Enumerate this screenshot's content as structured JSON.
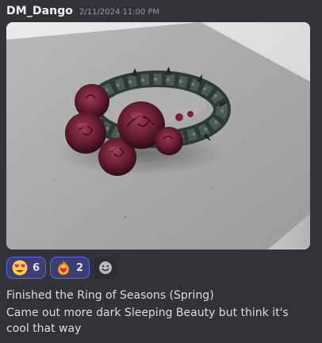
{
  "message": {
    "author": "DM_Dango",
    "timestamp": "2/11/2024 11:00 PM",
    "attachment": {
      "icon": "image-attachment"
    },
    "reactions": [
      {
        "emoji": "heart-eyes-emoji",
        "count": "6",
        "reacted": true
      },
      {
        "emoji": "heart-on-fire-emoji",
        "count": "2",
        "reacted": true
      }
    ],
    "add_reaction_icon": "smiley-icon",
    "lines": [
      "Finished the Ring of Seasons (Spring)",
      "Came out more dark Sleeping Beauty but think it's cool that way"
    ]
  },
  "colors": {
    "background": "#313338",
    "reaction_bg": "#3d3f73",
    "reaction_border": "#5865f2",
    "username": "#f2f3f5",
    "timestamp": "#949ba4",
    "text": "#dbdee1"
  }
}
